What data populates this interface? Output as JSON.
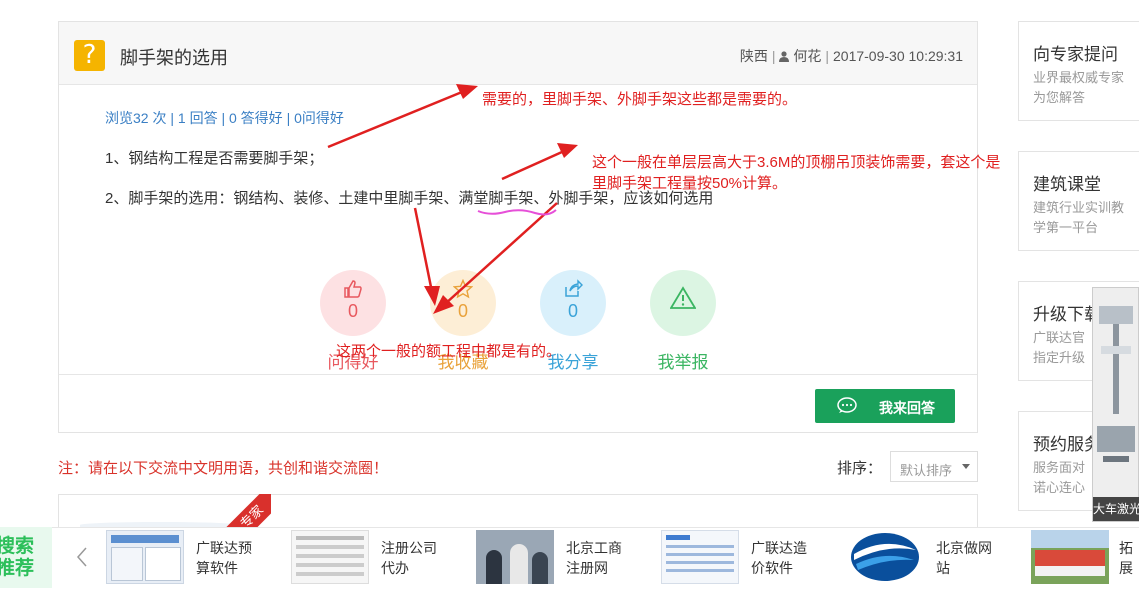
{
  "question": {
    "title": "脚手架的选用",
    "region": "陕西",
    "author": "何花",
    "datetime": "2017-09-30 10:29:31",
    "stats": {
      "views": "浏览32 次",
      "answers": "1 回答",
      "good_answers": "0 答得好",
      "good_questions": "0问得好"
    },
    "line1": "1、钢结构工程是否需要脚手架；",
    "line2_prefix": "2、脚手架的选用：钢结构、装修、土建中里脚手架、",
    "line2_highlight": "满堂脚手架",
    "line2_suffix": "、外脚手架，应该如何选用"
  },
  "actions": [
    {
      "id": "good",
      "count": "0",
      "label": "问得好",
      "color": "#e8595f",
      "bg": "#fde1e3",
      "icon": "thumbs-up-icon"
    },
    {
      "id": "collect",
      "count": "0",
      "label": "我收藏",
      "color": "#e9a23b",
      "bg": "#fdeed6",
      "icon": "star-icon"
    },
    {
      "id": "share",
      "count": "0",
      "label": "我分享",
      "color": "#3aa3d8",
      "bg": "#d9f0fb",
      "icon": "share-icon"
    },
    {
      "id": "report",
      "count": "",
      "label": "我举报",
      "color": "#3bb562",
      "bg": "#dcf5e3",
      "icon": "warning-icon"
    }
  ],
  "answer_button": "我来回答",
  "notice": "注：请在以下交流中文明用语，共创和谐交流圈！",
  "sort": {
    "label": "排序：",
    "value": "默认排序"
  },
  "ribbon_text": "专家",
  "annotations": {
    "a1": "需要的，里脚手架、外脚手架这些都是需要的。",
    "a2_line1": "这个一般在单层层高大于3.6M的顶棚吊顶装饰需要，套这个是",
    "a2_line2": "里脚手架工程量按50%计算。",
    "a3": "这两个一般的额工程中都是有的。"
  },
  "sidebar": [
    {
      "title": "向专家提问",
      "desc1": "业界最权威专家",
      "desc2": "为您解答"
    },
    {
      "title": "建筑课堂",
      "desc1": "建筑行业实训教",
      "desc2": "学第一平台"
    },
    {
      "title": "升级下载",
      "desc1": "广联达官",
      "desc2": "指定升级"
    },
    {
      "title": "预约服务",
      "desc1": "服务面对",
      "desc2": "诺心连心"
    }
  ],
  "float_caption": "大车激光",
  "search_tag": {
    "a": "搜索",
    "b": "推荐"
  },
  "ads": [
    {
      "l1": "广联达预",
      "l2": "算软件"
    },
    {
      "l1": "注册公司",
      "l2": "代办"
    },
    {
      "l1": "北京工商",
      "l2": "注册网"
    },
    {
      "l1": "广联达造",
      "l2": "价软件"
    },
    {
      "l1": "北京做网",
      "l2": "站"
    },
    {
      "l1": "拓展",
      "l2": ""
    }
  ]
}
